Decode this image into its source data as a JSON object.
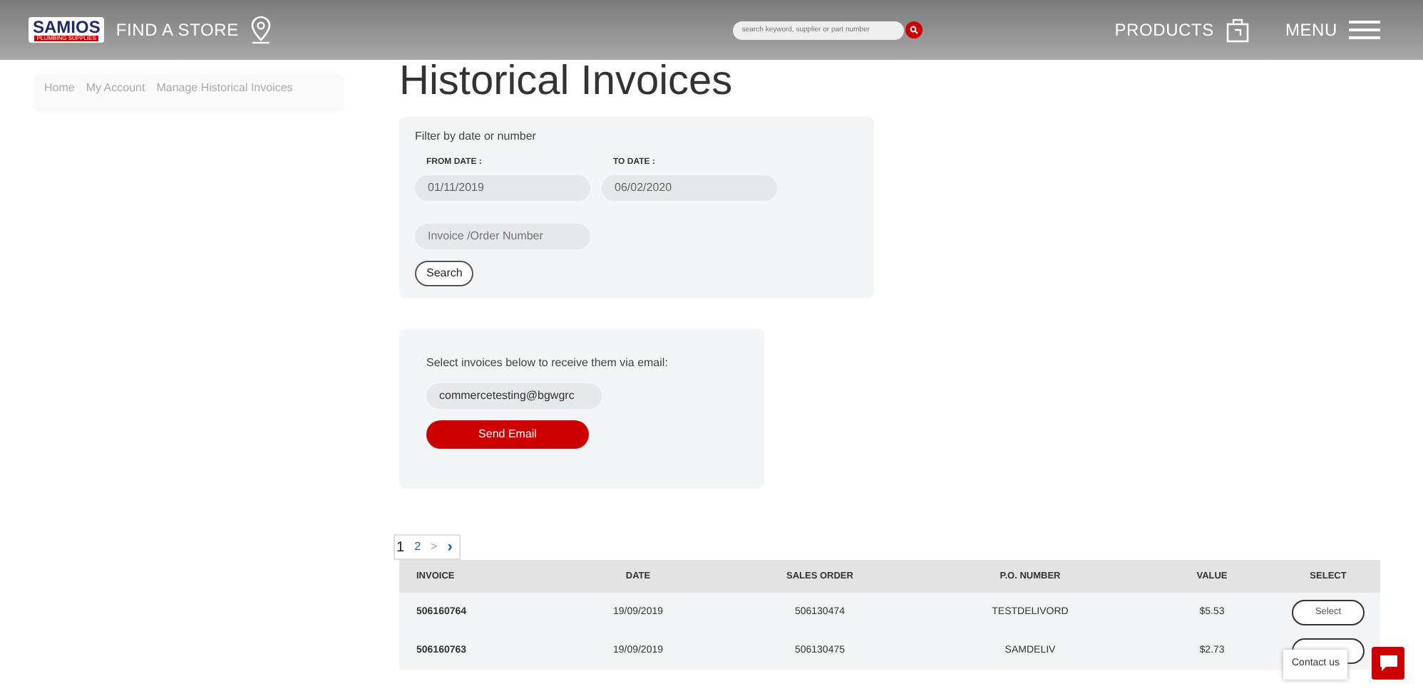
{
  "header": {
    "logo": {
      "top": "SAMIOS",
      "bottom": "PLUMBING SUPPLIES"
    },
    "find_store": "FIND A STORE",
    "search": {
      "placeholder": "search keyword, supplier or part number"
    },
    "products": "PRODUCTS",
    "menu": "MENU"
  },
  "breadcrumb": [
    "Home",
    "My Account",
    "Manage Historical Invoices"
  ],
  "title": "Historical Invoices",
  "filter": {
    "heading": "Filter by date or number",
    "from_label": "FROM DATE :",
    "from_value": "01/11/2019",
    "to_label": "TO DATE :",
    "to_value": "06/02/2020",
    "number": {
      "placeholder": "Invoice /Order Number"
    },
    "button": "Search"
  },
  "email": {
    "text": "Select invoices below to receive them via email:",
    "address": "commercetesting@bgwgrc",
    "button": "Send Email"
  },
  "pagination": [
    {
      "label": "1",
      "kind": "page",
      "selected": true
    },
    {
      "label": "2",
      "kind": "page",
      "selected": false
    },
    {
      "label": ">",
      "kind": "next",
      "selected": false
    },
    {
      "label": "›",
      "kind": "last",
      "selected": false
    }
  ],
  "table": {
    "columns": [
      "INVOICE",
      "DATE",
      "SALES ORDER",
      "P.O. NUMBER",
      "VALUE",
      "SELECT"
    ],
    "rows": [
      {
        "cells": [
          "506160764",
          "19/09/2019",
          "506130474",
          "TESTDELIVORD",
          "$5.53"
        ],
        "select": "Select"
      },
      {
        "cells": [
          "506160763",
          "19/09/2019",
          "506130475",
          "SAMDELIV",
          "$2.73"
        ]
      }
    ]
  },
  "contact": "Contact us"
}
